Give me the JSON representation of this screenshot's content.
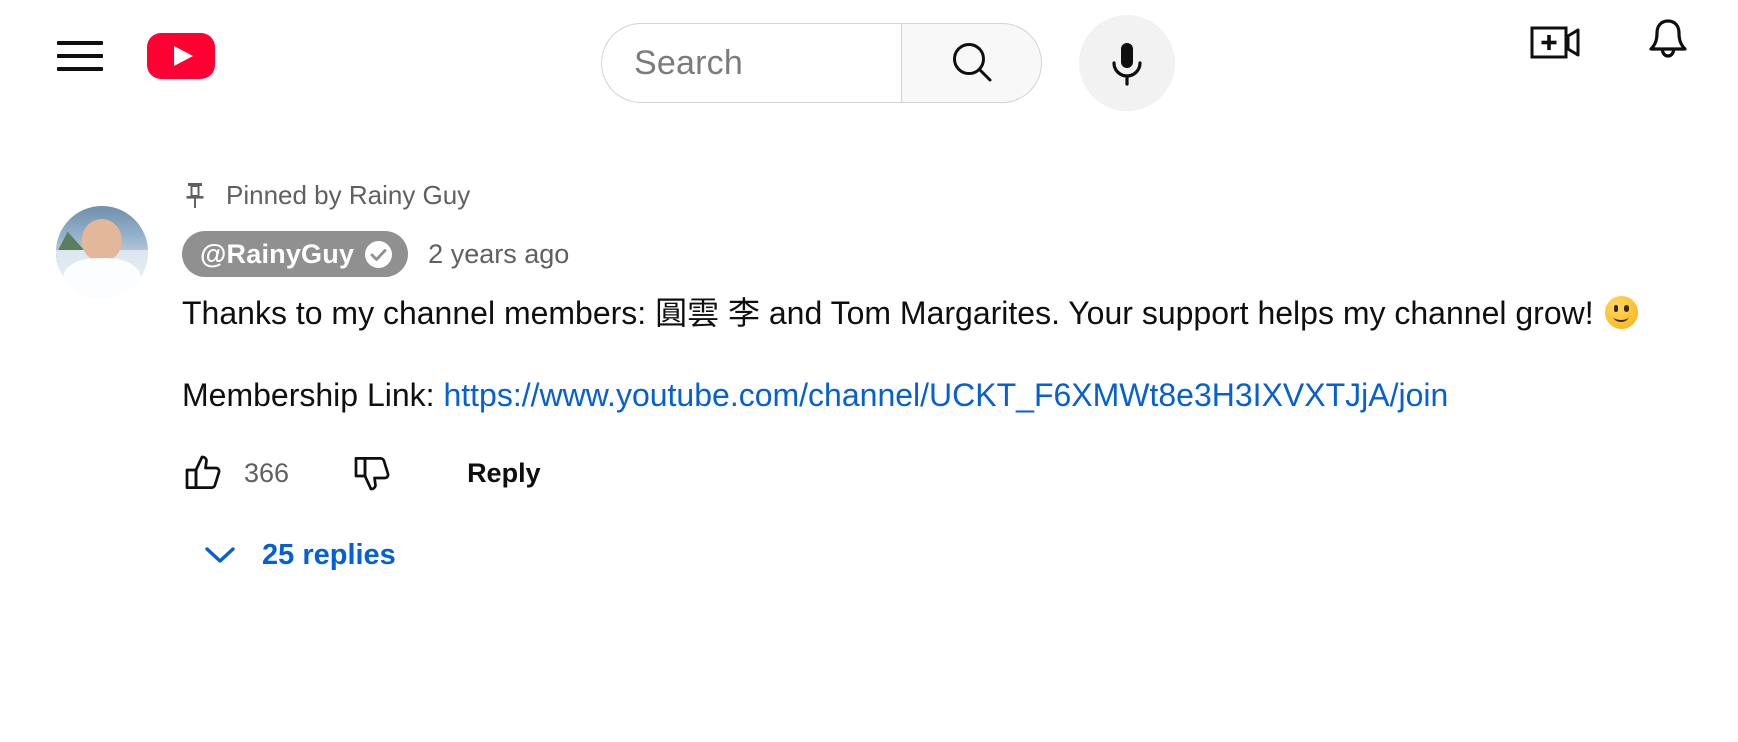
{
  "masthead": {
    "guide_icon": "hamburger-menu-icon",
    "logo_icon": "youtube-logo-icon",
    "search": {
      "placeholder": "Search",
      "value": "",
      "submit_icon": "search-icon"
    },
    "voice_search_icon": "microphone-icon",
    "create_icon": "create-video-icon",
    "notifications_icon": "bell-icon"
  },
  "comment": {
    "pinned_label": "Pinned by Rainy Guy",
    "pin_icon": "pin-icon",
    "author_handle": "@RainyGuy",
    "verified_icon": "verified-check-icon",
    "timestamp": "2 years ago",
    "text_line_1": "Thanks to my channel members: 圓雲 李 and Tom Margarites. Your support helps my channel grow! ",
    "emoji": "slightly-smiling-face",
    "link_prefix": "Membership Link: ",
    "link_text": "https://www.youtube.com/channel/UCKT_F6XMWt8e3H3IXVXTJjA/join",
    "like_icon": "thumbs-up-icon",
    "like_count": "366",
    "dislike_icon": "thumbs-down-icon",
    "reply_label": "Reply",
    "replies_label": "25 replies",
    "replies_chevron_icon": "chevron-down-icon"
  },
  "colors": {
    "brand_red": "#FF0033",
    "link_blue": "#065fd4",
    "chip_gray": "#909090",
    "secondary_text": "#606060",
    "primary_text": "#0f0f0f"
  }
}
